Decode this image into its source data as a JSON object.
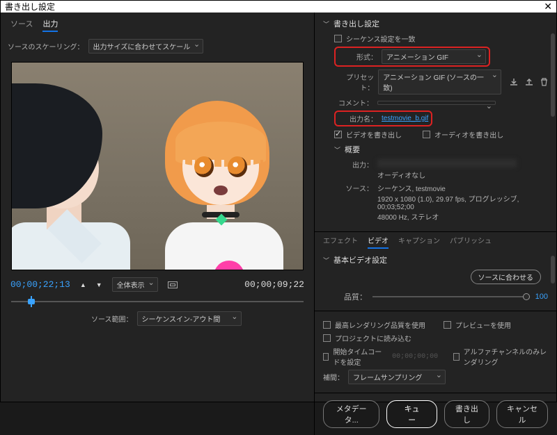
{
  "window": {
    "title": "書き出し設定"
  },
  "left": {
    "tabs": {
      "source": "ソース",
      "output": "出力"
    },
    "scaling": {
      "label": "ソースのスケーリング：",
      "value": "出力サイズに合わせてスケール"
    },
    "timecode_in": "00;00;22;13",
    "timecode_out": "00;00;09;22",
    "fit_select": "全体表示",
    "range": {
      "label": "ソース範囲：",
      "value": "シーケンスイン-アウト間"
    }
  },
  "export": {
    "heading": "書き出し設定",
    "match_sequence": "シーケンス設定を一致",
    "format": {
      "label": "形式：",
      "value": "アニメーション GIF"
    },
    "preset": {
      "label": "プリセット：",
      "value": "アニメーション GIF (ソースの一致)"
    },
    "comment": {
      "label": "コメント：",
      "value": ""
    },
    "outname": {
      "label": "出力名：",
      "value": "testmovie_b.gif"
    },
    "export_video": "ビデオを書き出し",
    "export_audio": "オーディオを書き出し",
    "summary": {
      "heading": "概要",
      "out_label": "出力：",
      "audio_none": "オーディオなし",
      "source_label": "ソース：",
      "source_seq": "シーケンス, testmovie",
      "source_line1": "1920 x 1080 (1.0), 29.97 fps, プログレッシブ, 00;03;52;00",
      "source_line2": "48000 Hz, ステレオ"
    }
  },
  "vtabs": {
    "effects": "エフェクト",
    "video": "ビデオ",
    "caption": "キャプション",
    "publish": "パブリッシュ"
  },
  "video": {
    "basic_heading": "基本ビデオ設定",
    "match_source_btn": "ソースに合わせる",
    "quality_label": "品質：",
    "quality_value": "100"
  },
  "bottom": {
    "max_quality": "最高レンダリング品質を使用",
    "use_preview": "プレビューを使用",
    "import_proj": "プロジェクトに読み込む",
    "set_tc": "開始タイムコードを設定",
    "tc_placeholder": "00;00;00;00",
    "alpha_only": "アルファチャンネルのみレンダリング",
    "interp_label": "補間：",
    "interp_value": "フレームサンプリング"
  },
  "buttons": {
    "metadata": "メタデータ...",
    "queue": "キュー",
    "export": "書き出し",
    "cancel": "キャンセル"
  }
}
